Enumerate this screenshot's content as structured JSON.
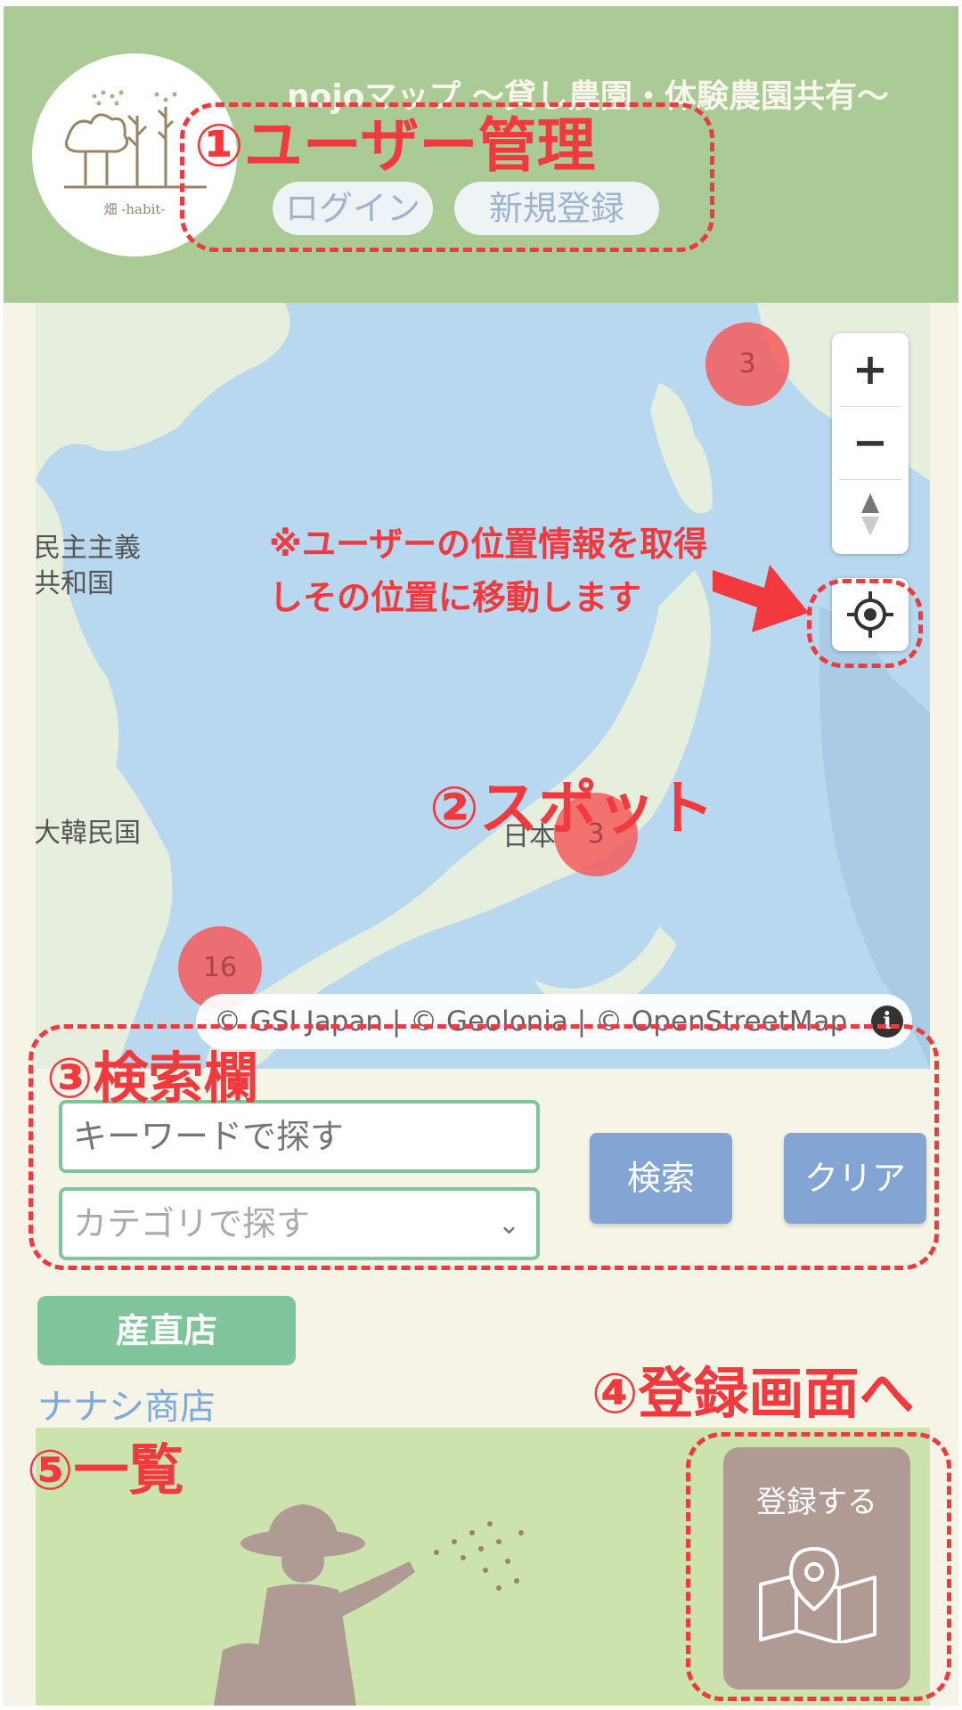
{
  "header": {
    "app_title": "nojoマップ ～貸し農園・体験農園共有～",
    "logo_text": "畑 -habit-",
    "login_label": "ログイン",
    "signup_label": "新規登録"
  },
  "map": {
    "labels": {
      "north_korea_1": "民主主義",
      "north_korea_2": "共和国",
      "south_korea": "大韓民国",
      "japan": "日本"
    },
    "clusters": [
      "3",
      "3",
      "16"
    ],
    "attribution": "© GSI Japan | © Geolonia | © OpenStreetMap",
    "controls": [
      "zoom-in",
      "zoom-out",
      "compass",
      "geolocate"
    ]
  },
  "search": {
    "keyword_placeholder": "キーワードで探す",
    "category_placeholder": "カテゴリで探す",
    "search_label": "検索",
    "clear_label": "クリア"
  },
  "list": {
    "tag": "産直店",
    "shop_name": "ナナシ商店",
    "register_label": "登録する"
  },
  "annotations": {
    "user_management": "①ユーザー管理",
    "location_note_1": "※ユーザーの位置情報を取得",
    "location_note_2": "しその位置に移動します",
    "spot": "②スポット",
    "search_area": "③検索欄",
    "to_register": "④登録画面へ",
    "list": "⑤一覧"
  },
  "colors": {
    "header_green": "#aaca96",
    "accent_green": "#7fc49c",
    "button_blue": "#82a5d3",
    "register_brown": "#b09a94",
    "annotation_red": "#f2393d"
  }
}
